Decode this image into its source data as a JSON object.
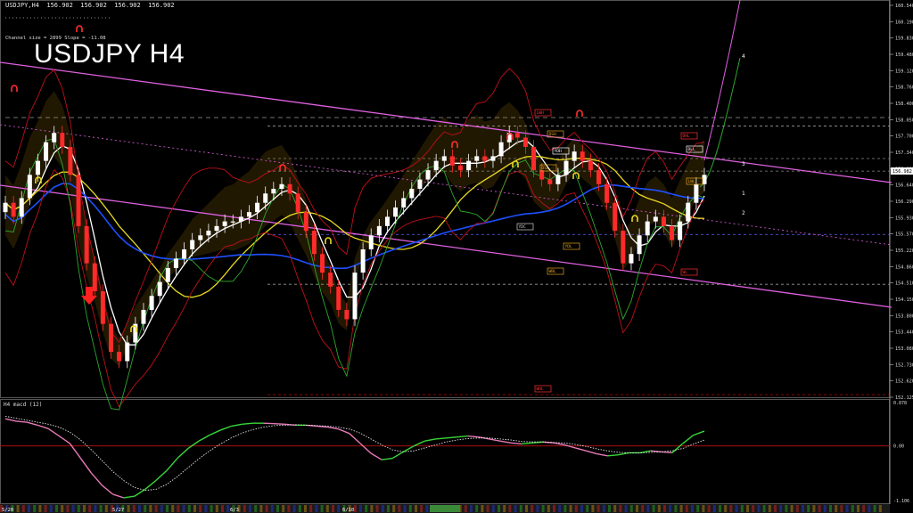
{
  "header": {
    "symbol_line": "USDJPY,H4  156.902  156.902  156.902  156.902",
    "big_title": "USDJPY H4",
    "channel_info": "Channel size = 2899  Slope = -11.08"
  },
  "macd": {
    "label": "H4  macd (12)",
    "ticks": [
      "0.878",
      "0.00",
      "-1.106"
    ]
  },
  "colors": {
    "bull": "#ffffff",
    "bear": "#ff2a2a",
    "channel": "#e060e0",
    "white_ma": "#ffffff",
    "yellow_ma": "#e8d820",
    "blue_ma": "#1e50ff",
    "green_line": "#2ea82e",
    "red_band": "#c0101a",
    "grid_gray": "#9a9a9a",
    "macd_main": "#38d838",
    "macd_neg": "#e87ab8",
    "macd_signal": "#ffffff",
    "zero_line": "#c01010"
  },
  "chart_data": {
    "type": "candlestick",
    "symbol": "USDJPY",
    "timeframe": "H4",
    "y_range": [
      152.125,
      160.54
    ],
    "price_ticks": [
      "160.540",
      "160.190",
      "159.830",
      "159.480",
      "159.120",
      "158.760",
      "158.400",
      "158.050",
      "157.700",
      "157.340",
      "156.982",
      "156.640",
      "156.290",
      "155.930",
      "155.570",
      "155.220",
      "154.860",
      "154.510",
      "154.150",
      "153.800",
      "153.440",
      "153.080",
      "152.730",
      "152.620",
      "152.125"
    ],
    "current_price": "156.982",
    "x_labels": [
      "5/20",
      "5/27",
      "6/3",
      "6/10"
    ],
    "closes": [
      156.3,
      156.0,
      156.4,
      156.9,
      157.2,
      157.6,
      157.8,
      157.5,
      156.9,
      155.8,
      155.0,
      154.4,
      153.7,
      153.1,
      152.9,
      153.3,
      153.7,
      154.0,
      154.3,
      154.6,
      154.9,
      155.1,
      155.3,
      155.5,
      155.6,
      155.7,
      155.8,
      155.9,
      155.9,
      156.0,
      156.1,
      156.3,
      156.5,
      156.6,
      156.7,
      156.5,
      156.1,
      155.7,
      155.2,
      154.8,
      154.5,
      154.0,
      153.8,
      154.8,
      155.3,
      155.6,
      155.8,
      156.0,
      156.2,
      156.4,
      156.6,
      156.8,
      157.0,
      157.2,
      157.3,
      157.1,
      157.0,
      157.2,
      157.3,
      157.2,
      157.3,
      157.6,
      157.8,
      157.7,
      157.5,
      157.0,
      156.8,
      156.7,
      156.9,
      157.2,
      157.4,
      157.2,
      157.0,
      156.7,
      156.3,
      155.7,
      155.0,
      155.2,
      155.6,
      155.9,
      156.0,
      155.8,
      155.5,
      155.9,
      156.3,
      156.7,
      156.9
    ],
    "series": [
      {
        "name": "MACD",
        "values": [
          0.55,
          0.5,
          0.48,
          0.42,
          0.35,
          0.2,
          0.05,
          -0.25,
          -0.55,
          -0.8,
          -0.98,
          -1.05,
          -1.02,
          -0.88,
          -0.7,
          -0.5,
          -0.25,
          -0.05,
          0.1,
          0.22,
          0.32,
          0.4,
          0.44,
          0.46,
          0.46,
          0.45,
          0.44,
          0.42,
          0.42,
          0.4,
          0.38,
          0.34,
          0.25,
          0.05,
          -0.15,
          -0.28,
          -0.25,
          -0.12,
          0.0,
          0.1,
          0.14,
          0.16,
          0.18,
          0.2,
          0.18,
          0.14,
          0.1,
          0.06,
          0.04,
          0.06,
          0.08,
          0.06,
          0.02,
          -0.04,
          -0.1,
          -0.16,
          -0.2,
          -0.18,
          -0.14,
          -0.14,
          -0.1,
          -0.12,
          -0.14,
          0.05,
          0.22,
          0.3
        ]
      },
      {
        "name": "Signal",
        "values": [
          0.6,
          0.56,
          0.52,
          0.48,
          0.44,
          0.38,
          0.28,
          0.12,
          -0.08,
          -0.3,
          -0.52,
          -0.7,
          -0.84,
          -0.9,
          -0.88,
          -0.78,
          -0.62,
          -0.44,
          -0.26,
          -0.1,
          0.04,
          0.16,
          0.26,
          0.33,
          0.38,
          0.41,
          0.42,
          0.43,
          0.42,
          0.41,
          0.4,
          0.38,
          0.34,
          0.26,
          0.14,
          0.02,
          -0.08,
          -0.12,
          -0.1,
          -0.04,
          0.02,
          0.08,
          0.12,
          0.15,
          0.16,
          0.16,
          0.14,
          0.12,
          0.09,
          0.08,
          0.08,
          0.07,
          0.06,
          0.03,
          -0.01,
          -0.06,
          -0.1,
          -0.13,
          -0.14,
          -0.14,
          -0.13,
          -0.12,
          -0.1,
          -0.05,
          0.04,
          0.12
        ]
      }
    ],
    "macd_range": [
      -1.106,
      0.878
    ],
    "markers": [
      "1",
      "2",
      "3",
      "4"
    ],
    "level_labels": [
      "LWH",
      "DSH",
      "DSL",
      "YDH",
      "YDL",
      "WBL",
      "DHL",
      "DLL",
      "LWL",
      "WL",
      "WHL",
      "YDC"
    ]
  }
}
